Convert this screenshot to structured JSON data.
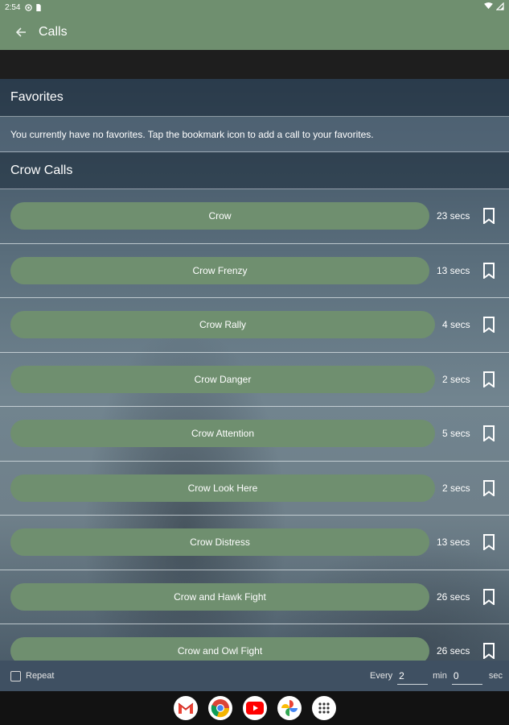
{
  "status_bar": {
    "time": "2:54"
  },
  "app_bar": {
    "title": "Calls"
  },
  "favorites": {
    "header": "Favorites",
    "empty_message": "You currently have no favorites. Tap the bookmark icon to add a call to your favorites."
  },
  "crow_calls": {
    "header": "Crow Calls",
    "items": [
      {
        "label": "Crow",
        "duration": "23 secs"
      },
      {
        "label": "Crow Frenzy",
        "duration": "13 secs"
      },
      {
        "label": "Crow Rally",
        "duration": "4 secs"
      },
      {
        "label": "Crow Danger",
        "duration": "2 secs"
      },
      {
        "label": "Crow Attention",
        "duration": "5 secs"
      },
      {
        "label": "Crow Look Here",
        "duration": "2 secs"
      },
      {
        "label": "Crow Distress",
        "duration": "13 secs"
      },
      {
        "label": "Crow and Hawk Fight",
        "duration": "26 secs"
      },
      {
        "label": "Crow and Owl Fight",
        "duration": "26 secs"
      }
    ]
  },
  "footer": {
    "repeat_label": "Repeat",
    "repeat_checked": false,
    "every_label": "Every",
    "min_value": "2",
    "min_label": "min",
    "sec_value": "0",
    "sec_label": "sec"
  },
  "nav_apps": [
    "gmail-icon",
    "chrome-icon",
    "youtube-icon",
    "photos-icon",
    "app-drawer-icon"
  ],
  "colors": {
    "accent": "#6f8f6f",
    "footer": "#3f5062",
    "nav": "#121212"
  }
}
